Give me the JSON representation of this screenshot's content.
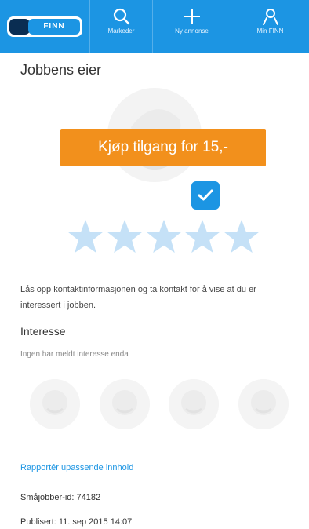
{
  "topbar": {
    "logo_text": "FINN",
    "tabs": [
      {
        "label": "Markeder",
        "icon": "search-icon"
      },
      {
        "label": "Ny annonse",
        "icon": "plus-icon"
      },
      {
        "label": "Min FINN",
        "icon": "user-icon"
      }
    ]
  },
  "job_owner": {
    "title": "Jobbens eier",
    "buy_button_label": "Kjøp tilgang for 15,-",
    "verified_icon": "checkmark-icon",
    "rating_stars": 5
  },
  "description": "Lås opp kontaktinformasjonen og ta kontakt for å vise at du er interessert i jobben.",
  "interest": {
    "title": "Interesse",
    "empty_text": "Ingen har meldt interesse enda"
  },
  "footer": {
    "report_link": "Rapportér upassende innhold",
    "id_label": "Småjobber-id:",
    "id_value": "74182",
    "published_label": "Publisert:",
    "published_value": "11. sep 2015 14:07"
  },
  "colors": {
    "brand_blue": "#1c95e3",
    "brand_navy": "#0a2d52",
    "buy_orange": "#f2901c",
    "star_blue": "#c5e1f7"
  }
}
